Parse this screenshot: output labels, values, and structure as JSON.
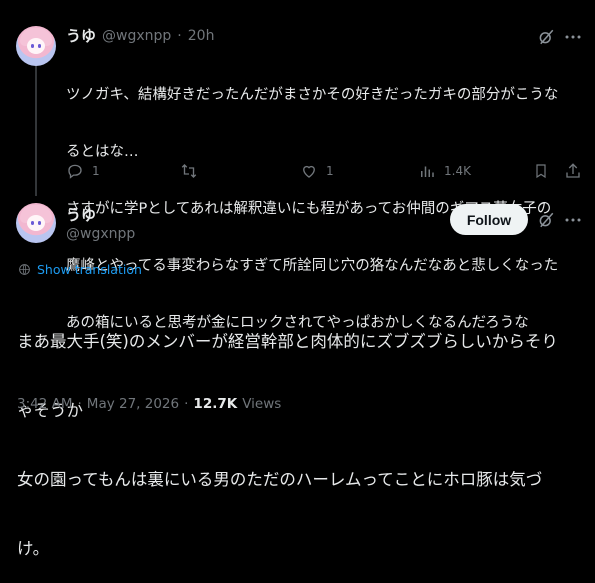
{
  "reply_tweet": {
    "display_name": "うゆ",
    "handle": "@wgxnpp",
    "separator": "·",
    "time": "20h",
    "text_lines": [
      "ツノガキ、結構好きだったんだがまさかその好きだったガキの部分がこうな",
      "るとはな…",
      "さすがに学Pとしてあれは解釈違いにも程があってお仲間のギアス夢女子の",
      "鷹峰とやってる事変わらなすぎて所詮同じ穴の狢なんだなあと悲しくなった",
      "あの箱にいると思考が金にロックされてやっぱおかしくなるんだろうな"
    ],
    "actions": {
      "reply_count": "1",
      "retweet_count": "",
      "like_count": "1",
      "views_count": "1.4K"
    }
  },
  "main_tweet": {
    "display_name": "うゆ",
    "handle": "@wgxnpp",
    "follow_label": "Follow",
    "show_translation_label": "Show translation",
    "text_lines": [
      "まあ最大手(笑)のメンバーが経営幹部と肉体的にズブズブらしいからそり",
      "ゃそうか",
      "女の園ってもんは裏にいる男のただのハーレムってことにホロ豚は気づ",
      "け。"
    ],
    "time": "3:42 AM",
    "separator": "·",
    "date": "May 27, 2026",
    "separator2": "·",
    "views_count": "12.7K",
    "views_label": "Views"
  },
  "colors": {
    "background": "#000000",
    "text": "#e7e9ea",
    "muted": "#71767b",
    "link": "#1d9bf0",
    "follow_bg": "#eff3f4"
  },
  "icons": [
    "grok-icon",
    "more-icon",
    "reply-icon",
    "retweet-icon",
    "like-icon",
    "views-icon",
    "bookmark-icon",
    "share-icon",
    "translate-icon"
  ]
}
